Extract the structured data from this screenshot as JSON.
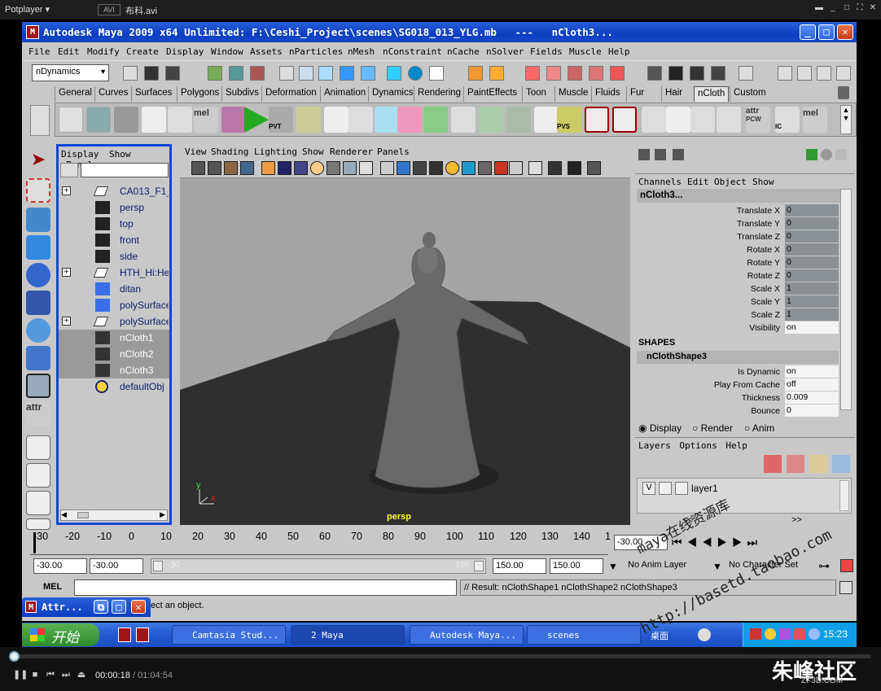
{
  "player": {
    "title": "Potplayer ▾",
    "format": "AVI",
    "filename": "布科.avi",
    "time_current": "00:00:18",
    "time_total": "/ 01:04:54",
    "seek_fraction": 0.005
  },
  "maya": {
    "title": "Autodesk Maya 2009 x64 Unlimited: F:\\Ceshi_Project\\scenes\\SG018_013_YLG.mb   ---   nCloth3...",
    "menus": [
      "File",
      "Edit",
      "Modify",
      "Create",
      "Display",
      "Window",
      "Assets",
      "nParticles",
      "nMesh",
      "nConstraint",
      "nCache",
      "nSolver",
      "Fields",
      "Muscle",
      "Help"
    ],
    "menu_set": "nDynamics",
    "shelf_tabs": [
      "General",
      "Curves",
      "Surfaces",
      "Polygons",
      "Subdivs",
      "Deformation",
      "Animation",
      "Dynamics",
      "Rendering",
      "PaintEffects",
      "Toon",
      "Muscle",
      "Fluids",
      "Fur",
      "Hair",
      "nCloth",
      "Custom"
    ],
    "active_shelf_tab": "nCloth",
    "shelf_labels": {
      "mel1": "mel",
      "attr": "attr",
      "mel2": "mel",
      "pvt": "PVT",
      "pcw": "PCW",
      "ic": "IC",
      "pvs": "PVS"
    },
    "outliner": {
      "menu": [
        "Display",
        "Show",
        "Panels"
      ],
      "items": [
        {
          "label": "CA013_F1_",
          "expand": "+",
          "icon": "transform",
          "selected": false
        },
        {
          "label": "persp",
          "expand": "",
          "icon": "camera",
          "selected": false
        },
        {
          "label": "top",
          "expand": "",
          "icon": "camera",
          "selected": false
        },
        {
          "label": "front",
          "expand": "",
          "icon": "camera",
          "selected": false
        },
        {
          "label": "side",
          "expand": "",
          "icon": "camera",
          "selected": false
        },
        {
          "label": "HTH_Hi:He",
          "expand": "+",
          "icon": "transform",
          "selected": false
        },
        {
          "label": "ditan",
          "expand": "",
          "icon": "mesh",
          "selected": false
        },
        {
          "label": "polySurface",
          "expand": "",
          "icon": "mesh",
          "selected": false
        },
        {
          "label": "polySurface",
          "expand": "+",
          "icon": "transform",
          "selected": false
        },
        {
          "label": "nCloth1",
          "expand": "",
          "icon": "ncloth",
          "selected": true
        },
        {
          "label": "nCloth2",
          "expand": "",
          "icon": "ncloth",
          "selected": true
        },
        {
          "label": "nCloth3",
          "expand": "",
          "icon": "ncloth",
          "selected": true
        },
        {
          "label": "defaultObj",
          "expand": "",
          "icon": "set",
          "selected": false
        }
      ]
    },
    "viewport": {
      "menu": [
        "View",
        "Shading",
        "Lighting",
        "Show",
        "Renderer",
        "Panels"
      ],
      "camera_label": "persp",
      "axis_x": "x",
      "axis_y": "y"
    },
    "channel_box": {
      "menu": [
        "Channels",
        "Edit",
        "Object",
        "Show"
      ],
      "node": "nCloth3...",
      "channels": [
        {
          "name": "Translate X",
          "value": "0",
          "white": false
        },
        {
          "name": "Translate Y",
          "value": "0",
          "white": false
        },
        {
          "name": "Translate Z",
          "value": "0",
          "white": false
        },
        {
          "name": "Rotate X",
          "value": "0",
          "white": false
        },
        {
          "name": "Rotate Y",
          "value": "0",
          "white": false
        },
        {
          "name": "Rotate Z",
          "value": "0",
          "white": false
        },
        {
          "name": "Scale X",
          "value": "1",
          "white": false
        },
        {
          "name": "Scale Y",
          "value": "1",
          "white": false
        },
        {
          "name": "Scale Z",
          "value": "1",
          "white": false
        },
        {
          "name": "Visibility",
          "value": "on",
          "white": true
        }
      ],
      "shapes_header": "SHAPES",
      "shape_node": "nClothShape3",
      "shape_channels": [
        {
          "name": "Is Dynamic",
          "value": "on"
        },
        {
          "name": "Play From Cache",
          "value": "off"
        },
        {
          "name": "Thickness",
          "value": "0.009"
        },
        {
          "name": "Bounce",
          "value": "0"
        }
      ]
    },
    "layers": {
      "radios": [
        "Display",
        "Render",
        "Anim"
      ],
      "menu": [
        "Layers",
        "Options",
        "Help"
      ],
      "layer_vis": "V",
      "layer_name": "layer1",
      "nav_left": "<<",
      "nav_right": ">>"
    },
    "timeline": {
      "ticks": [
        "-30",
        "-20",
        "-10",
        "0",
        "10",
        "20",
        "30",
        "40",
        "50",
        "60",
        "70",
        "80",
        "90",
        "100",
        "110",
        "120",
        "130",
        "140",
        "1"
      ],
      "current_frame": "-30.00"
    },
    "range": {
      "start": "-30.00",
      "start2": "-30.00",
      "slider_left": "-30",
      "slider_right": "150",
      "end": "150.00",
      "end2": "150.00",
      "anim_layer": "No Anim Layer",
      "char_set": "No Character Set"
    },
    "mel_label": "MEL",
    "result": "// Result: nClothShape1 nClothShape2 nClothShape3",
    "help_text": "ect an object.",
    "attr_window": "Attr..."
  },
  "taskbar": {
    "start": "开始",
    "items": [
      "Camtasia Stud...",
      "2 Maya",
      "Autodesk Maya...",
      "scenes",
      "桌面"
    ],
    "clock": "15:23"
  },
  "watermark": {
    "line1": "maya在线资源库",
    "line2": "http://basetd.taobao.com",
    "logo": "朱峰社区",
    "logo_sub": "ZF3D.COM"
  }
}
